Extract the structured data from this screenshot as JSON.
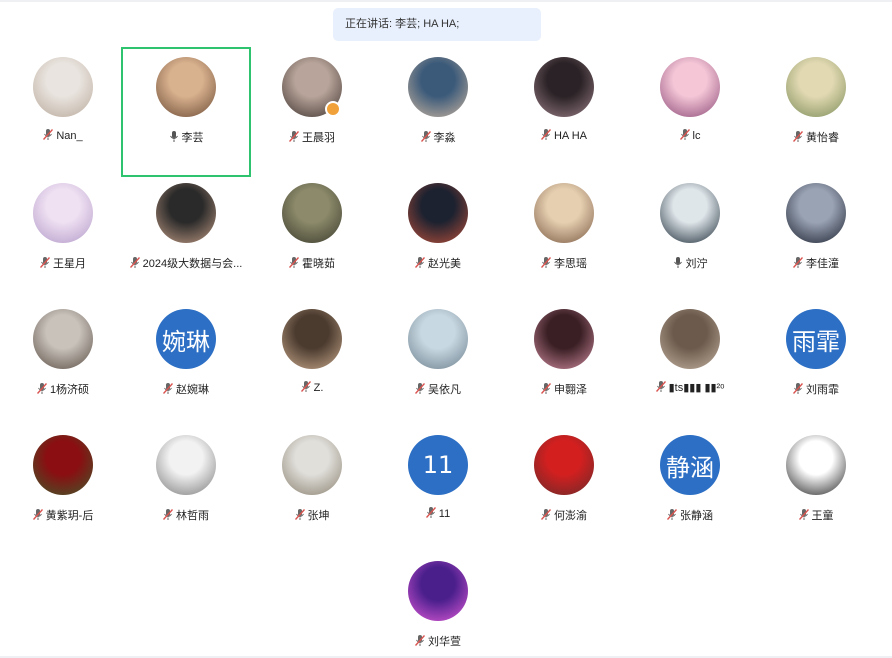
{
  "banner": {
    "text": "正在讲话: 李芸; HA HA;"
  },
  "colors": {
    "active_border": "#2ec46f",
    "text_avatar_bg": "#2c6fc4",
    "mic_muted": "#d9534f"
  },
  "participants": [
    {
      "name": "Nan_",
      "avatar_text": "",
      "muted": true,
      "speaking": false,
      "host": false
    },
    {
      "name": "李芸",
      "avatar_text": "",
      "muted": false,
      "speaking": true,
      "host": false
    },
    {
      "name": "王晨羽",
      "avatar_text": "",
      "muted": true,
      "speaking": false,
      "host": true
    },
    {
      "name": "李淼",
      "avatar_text": "",
      "muted": true,
      "speaking": false,
      "host": false
    },
    {
      "name": "HA HA",
      "avatar_text": "",
      "muted": true,
      "speaking": false,
      "host": false
    },
    {
      "name": "lc",
      "avatar_text": "",
      "muted": true,
      "speaking": false,
      "host": false
    },
    {
      "name": "黄怡睿",
      "avatar_text": "",
      "muted": true,
      "speaking": false,
      "host": false
    },
    {
      "name": "王星月",
      "avatar_text": "",
      "muted": true,
      "speaking": false,
      "host": false
    },
    {
      "name": "2024级大数据与会...",
      "avatar_text": "",
      "muted": true,
      "speaking": false,
      "host": false
    },
    {
      "name": "霍晓茹",
      "avatar_text": "",
      "muted": true,
      "speaking": false,
      "host": false
    },
    {
      "name": "赵光美",
      "avatar_text": "",
      "muted": true,
      "speaking": false,
      "host": false
    },
    {
      "name": "李思瑶",
      "avatar_text": "",
      "muted": true,
      "speaking": false,
      "host": false
    },
    {
      "name": "刘泞",
      "avatar_text": "",
      "muted": false,
      "speaking": false,
      "host": false
    },
    {
      "name": "李佳潼",
      "avatar_text": "",
      "muted": true,
      "speaking": false,
      "host": false
    },
    {
      "name": "1杨济硕",
      "avatar_text": "",
      "muted": true,
      "speaking": false,
      "host": false
    },
    {
      "name": "赵婉琳",
      "avatar_text": "婉琳",
      "muted": true,
      "speaking": false,
      "host": false
    },
    {
      "name": "Z.",
      "avatar_text": "",
      "muted": true,
      "speaking": false,
      "host": false
    },
    {
      "name": "吴依凡",
      "avatar_text": "",
      "muted": true,
      "speaking": false,
      "host": false
    },
    {
      "name": "申翾泽",
      "avatar_text": "",
      "muted": true,
      "speaking": false,
      "host": false
    },
    {
      "name": "▮ts▮▮▮ ▮▮²ᵒ",
      "avatar_text": "",
      "muted": true,
      "speaking": false,
      "host": false
    },
    {
      "name": "刘雨霏",
      "avatar_text": "雨霏",
      "muted": true,
      "speaking": false,
      "host": false
    },
    {
      "name": "黄紫玥-后",
      "avatar_text": "",
      "muted": true,
      "speaking": false,
      "host": false
    },
    {
      "name": "林哲雨",
      "avatar_text": "",
      "muted": true,
      "speaking": false,
      "host": false
    },
    {
      "name": "张坤",
      "avatar_text": "",
      "muted": true,
      "speaking": false,
      "host": false
    },
    {
      "name": "11",
      "avatar_text": "11",
      "muted": true,
      "speaking": false,
      "host": false
    },
    {
      "name": "何澎渝",
      "avatar_text": "",
      "muted": true,
      "speaking": false,
      "host": false
    },
    {
      "name": "张静涵",
      "avatar_text": "静涵",
      "muted": true,
      "speaking": false,
      "host": false
    },
    {
      "name": "王童",
      "avatar_text": "",
      "muted": true,
      "speaking": false,
      "host": false
    },
    {
      "name": "刘华萱",
      "avatar_text": "",
      "muted": true,
      "speaking": false,
      "host": false
    }
  ]
}
